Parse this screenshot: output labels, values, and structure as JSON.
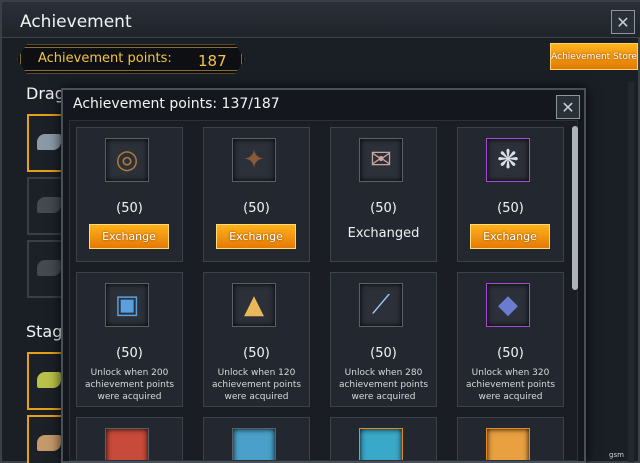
{
  "window": {
    "title": "Achievement"
  },
  "points_bar": {
    "label": "Achievement points:",
    "value": "187"
  },
  "store_button": {
    "label": "Achievement Store"
  },
  "sections": {
    "dragon": "Drag",
    "stage": "Stag"
  },
  "modal": {
    "title": "Achievement points: 137/187",
    "close": "×",
    "cards": [
      {
        "cost": "(50)",
        "status": "Exchange",
        "icon": "bracelet-icon",
        "glyph": "◎",
        "tint": "#b07a3a",
        "frame": "default"
      },
      {
        "cost": "(50)",
        "status": "Exchange",
        "icon": "armor-icon",
        "glyph": "✦",
        "tint": "#8a5a3a",
        "frame": "default"
      },
      {
        "cost": "(50)",
        "status": "Exchanged",
        "icon": "scroll-icon",
        "glyph": "✉",
        "tint": "#c9a6a0",
        "frame": "default"
      },
      {
        "cost": "(50)",
        "status": "Exchange",
        "icon": "dragon-icon",
        "glyph": "❋",
        "tint": "#d8e0ea",
        "frame": "purple"
      },
      {
        "cost": "(50)",
        "note": "Unlock when 200 achievement points were acquired",
        "icon": "cube-icon",
        "glyph": "▣",
        "tint": "#5aa0e0",
        "frame": "default"
      },
      {
        "cost": "(50)",
        "note": "Unlock when 120 achievement points were acquired",
        "icon": "pyramid-icon",
        "glyph": "▲",
        "tint": "#e8b85a",
        "frame": "default"
      },
      {
        "cost": "(50)",
        "note": "Unlock when 280 achievement points were acquired",
        "icon": "spear-icon",
        "glyph": "⟋",
        "tint": "#9fc8ff",
        "frame": "default"
      },
      {
        "cost": "(50)",
        "note": "Unlock when 320 achievement points were acquired",
        "icon": "cat-mask-icon",
        "glyph": "◆",
        "tint": "#6a7ccf",
        "frame": "purple"
      }
    ]
  },
  "watermark": "gsm"
}
